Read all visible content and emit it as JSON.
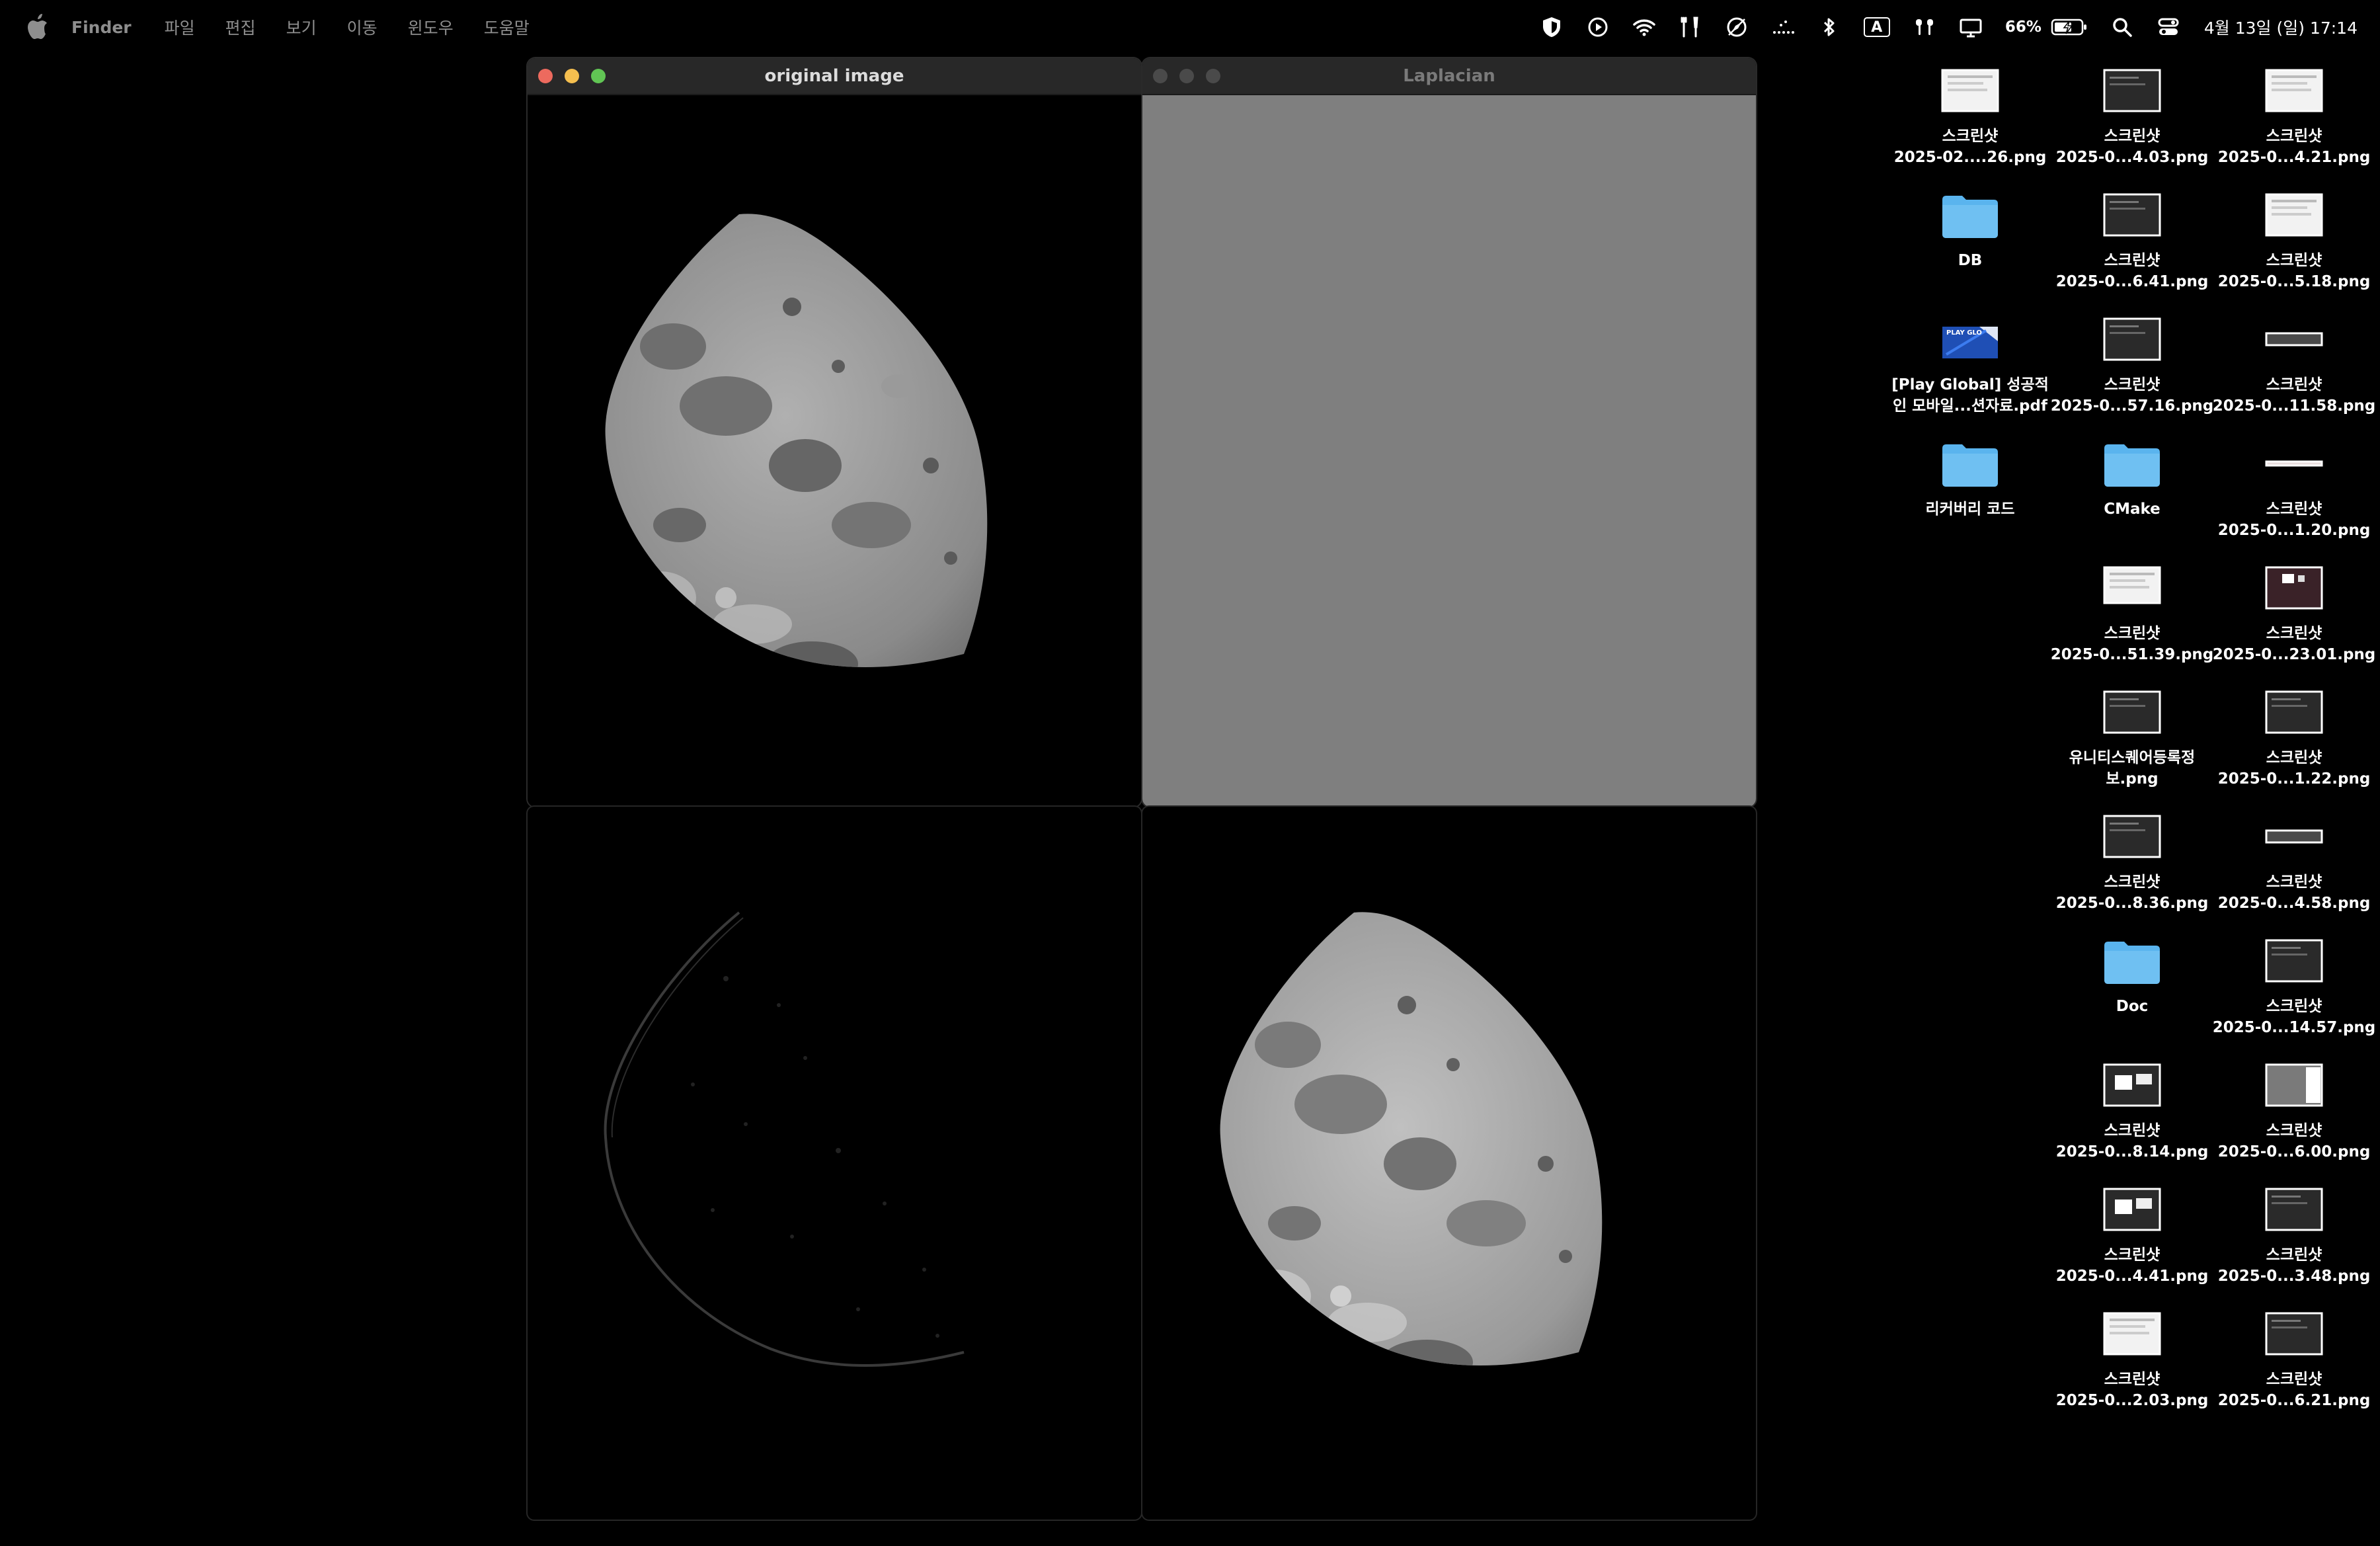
{
  "menubar": {
    "app_name": "Finder",
    "menus": [
      "파일",
      "편집",
      "보기",
      "이동",
      "윈도우",
      "도움말"
    ],
    "battery_percent": "66%",
    "input_source": "A",
    "clock": "4월 13일 (일) 17:14"
  },
  "windows": {
    "original": {
      "title": "original image"
    },
    "laplacian": {
      "title": "Laplacian"
    }
  },
  "desktop": {
    "items": [
      {
        "type": "screenshot",
        "line1": "스크린샷",
        "line2": "2025-02....26.png"
      },
      {
        "type": "screenshot",
        "line1": "스크린샷",
        "line2": "2025-0...4.03.png"
      },
      {
        "type": "screenshot",
        "line1": "스크린샷",
        "line2": "2025-0...4.21.png"
      },
      {
        "type": "folder",
        "line1": "DB",
        "line2": ""
      },
      {
        "type": "screenshot",
        "line1": "스크린샷",
        "line2": "2025-0...6.41.png"
      },
      {
        "type": "screenshot",
        "line1": "스크린샷",
        "line2": "2025-0...5.18.png"
      },
      {
        "type": "pdf",
        "line1": "[Play Global] 성공적",
        "line2": "인 모바일...션자료.pdf",
        "thumb_text": "PLAY GLO"
      },
      {
        "type": "screenshot",
        "line1": "스크린샷",
        "line2": "2025-0...57.16.png"
      },
      {
        "type": "screenshot",
        "line1": "스크린샷",
        "line2": "2025-0...11.58.png"
      },
      {
        "type": "folder",
        "line1": "리커버리 코드",
        "line2": ""
      },
      {
        "type": "folder",
        "line1": "CMake",
        "line2": ""
      },
      {
        "type": "screenshot",
        "line1": "스크린샷",
        "line2": "2025-0...1.20.png"
      },
      {
        "type": "screenshot",
        "line1": "스크린샷",
        "line2": "2025-0...51.39.png"
      },
      {
        "type": "screenshot",
        "line1": "스크린샷",
        "line2": "2025-0...23.01.png"
      },
      {
        "type": "screenshot",
        "line1": "유니티스퀘어등록정",
        "line2": "보.png"
      },
      {
        "type": "screenshot",
        "line1": "스크린샷",
        "line2": "2025-0...1.22.png"
      },
      {
        "type": "screenshot",
        "line1": "스크린샷",
        "line2": "2025-0...8.36.png"
      },
      {
        "type": "screenshot",
        "line1": "스크린샷",
        "line2": "2025-0...4.58.png"
      },
      {
        "type": "folder",
        "line1": "Doc",
        "line2": ""
      },
      {
        "type": "screenshot",
        "line1": "스크린샷",
        "line2": "2025-0...14.57.png"
      },
      {
        "type": "screenshot",
        "line1": "스크린샷",
        "line2": "2025-0...8.14.png"
      },
      {
        "type": "screenshot",
        "line1": "스크린샷",
        "line2": "2025-0...6.00.png"
      },
      {
        "type": "screenshot",
        "line1": "스크린샷",
        "line2": "2025-0...4.41.png"
      },
      {
        "type": "screenshot",
        "line1": "스크린샷",
        "line2": "2025-0...3.48.png"
      },
      {
        "type": "screenshot",
        "line1": "스크린샷",
        "line2": "2025-0...2.03.png"
      },
      {
        "type": "screenshot",
        "line1": "스크린샷",
        "line2": "2025-0...6.21.png"
      }
    ]
  },
  "colors": {
    "folder": "#5ab4ee",
    "close": "#ed6a5e",
    "minimize": "#f5bf4f",
    "maximize": "#61c554",
    "laplacian_fill": "#7f7f7f"
  }
}
